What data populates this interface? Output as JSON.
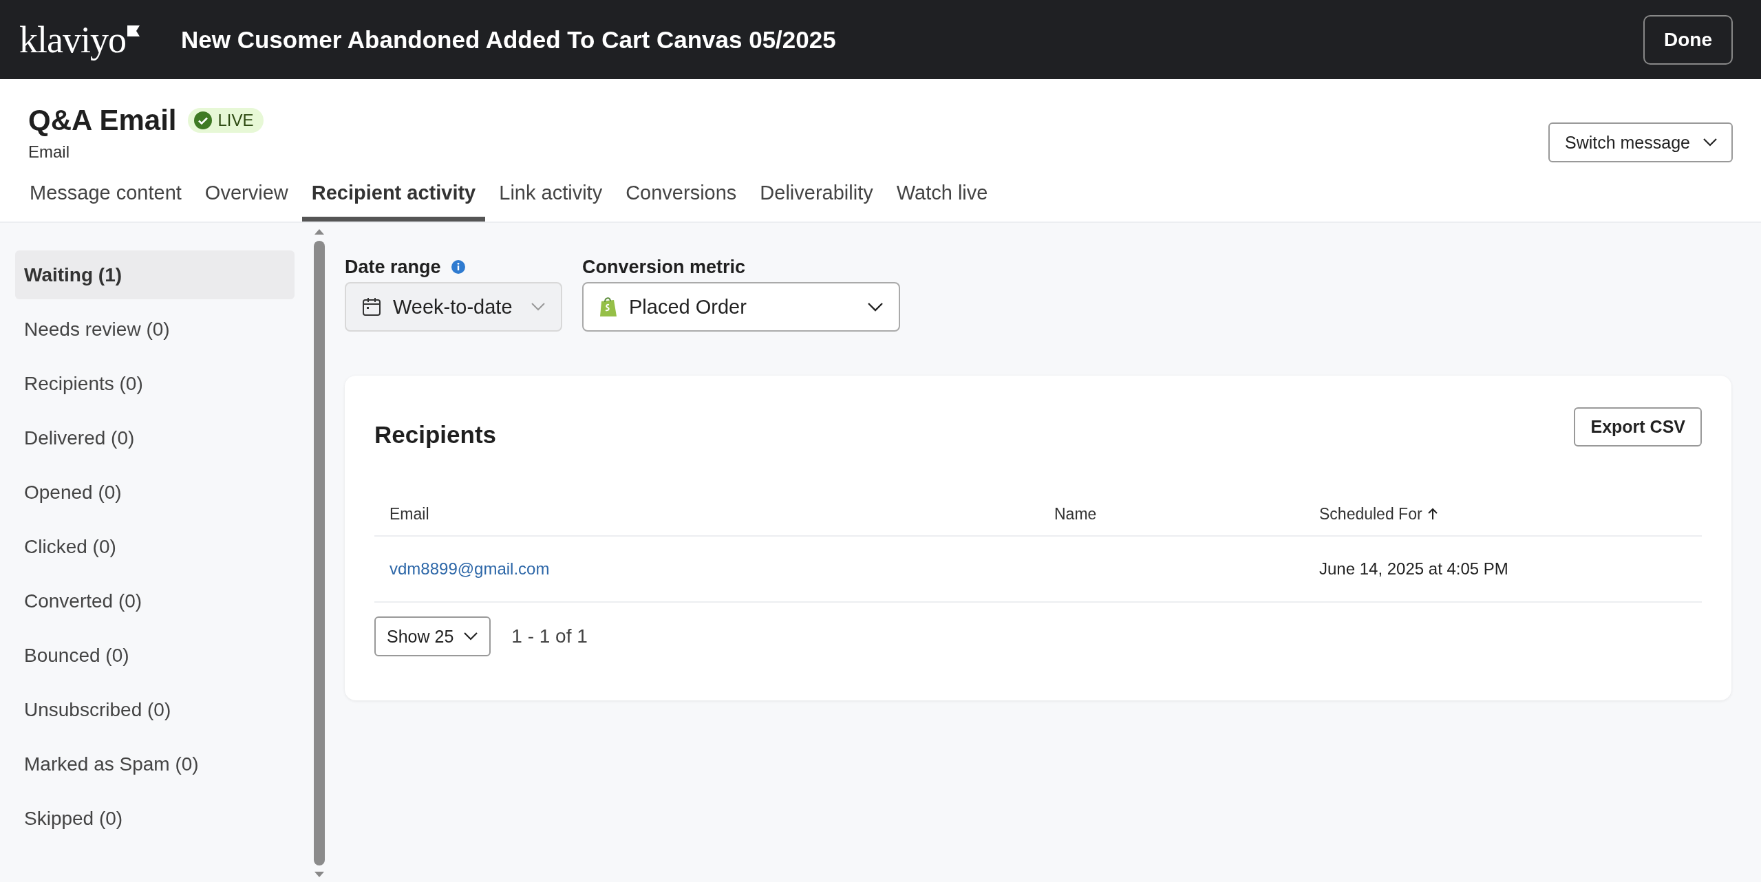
{
  "header": {
    "logo": "klaviyo",
    "title": "New Cusomer Abandoned Added To Cart Canvas 05/2025",
    "done_button": "Done"
  },
  "message": {
    "title": "Q&A Email",
    "status": "LIVE",
    "live": true,
    "type": "Email",
    "switch_button": "Switch message"
  },
  "tabs": [
    {
      "label": "Message content",
      "selected": false
    },
    {
      "label": "Overview",
      "selected": false
    },
    {
      "label": "Recipient activity",
      "selected": true
    },
    {
      "label": "Link activity",
      "selected": false
    },
    {
      "label": "Conversions",
      "selected": false
    },
    {
      "label": "Deliverability",
      "selected": false
    },
    {
      "label": "Watch live",
      "selected": false
    }
  ],
  "sidebar": {
    "items": [
      {
        "label": "Waiting (1)",
        "selected": true
      },
      {
        "label": "Needs review (0)",
        "selected": false
      },
      {
        "label": "Recipients (0)",
        "selected": false
      },
      {
        "label": "Delivered (0)",
        "selected": false
      },
      {
        "label": "Opened (0)",
        "selected": false
      },
      {
        "label": "Clicked (0)",
        "selected": false
      },
      {
        "label": "Converted (0)",
        "selected": false
      },
      {
        "label": "Bounced (0)",
        "selected": false
      },
      {
        "label": "Unsubscribed (0)",
        "selected": false
      },
      {
        "label": "Marked as Spam (0)",
        "selected": false
      },
      {
        "label": "Skipped (0)",
        "selected": false
      }
    ]
  },
  "filters": {
    "date_range": {
      "label": "Date range",
      "value": "Week-to-date",
      "disabled": true
    },
    "conversion_metric": {
      "label": "Conversion metric",
      "value": "Placed Order"
    }
  },
  "recipients": {
    "title": "Recipients",
    "export_button": "Export CSV",
    "columns": [
      {
        "label": "Email",
        "sorted": false
      },
      {
        "label": "Name",
        "sorted": false
      },
      {
        "label": "Scheduled For",
        "sorted": true
      }
    ],
    "rows": [
      {
        "email": "vdm8899@gmail.com",
        "scheduled_for": "June 14, 2025 at 4:05 PM"
      }
    ],
    "page_size": "Show 25",
    "page_info": "1 - 1 of 1"
  }
}
